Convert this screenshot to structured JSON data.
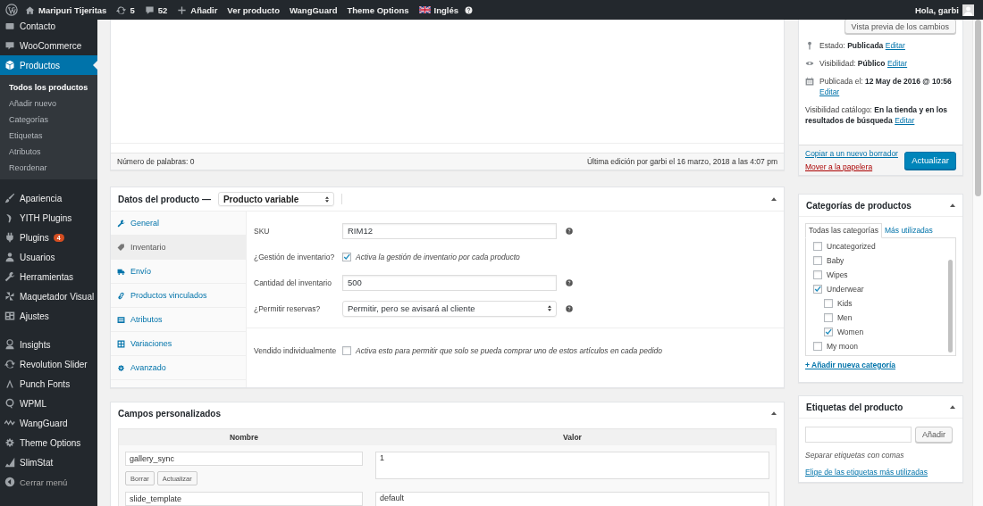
{
  "admin_bar": {
    "items": [
      {
        "kind": "home",
        "label": "Maripuri Tijeritas"
      },
      {
        "kind": "updates",
        "label": "5"
      },
      {
        "kind": "comments",
        "label": "52"
      },
      {
        "kind": "new",
        "label": "Añadir"
      },
      {
        "kind": "text",
        "label": "Ver producto"
      },
      {
        "kind": "text",
        "label": "WangGuard"
      },
      {
        "kind": "text",
        "label": "Theme Options"
      },
      {
        "kind": "language",
        "label": "Inglés"
      }
    ],
    "greeting": "Hola, garbi"
  },
  "sidebar": {
    "items": [
      {
        "kind": "item",
        "label": "Contacto",
        "selected": false
      },
      {
        "kind": "item",
        "label": "WooCommerce",
        "selected": false
      },
      {
        "kind": "item",
        "label": "Productos",
        "selected": true,
        "children": [
          {
            "label": "Todos los productos",
            "selected": true
          },
          {
            "label": "Añadir nuevo",
            "selected": false
          },
          {
            "label": "Categorías",
            "selected": false
          },
          {
            "label": "Etiquetas",
            "selected": false
          },
          {
            "label": "Atributos",
            "selected": false
          },
          {
            "label": "Reordenar",
            "selected": false
          }
        ]
      },
      {
        "kind": "separator"
      },
      {
        "kind": "item",
        "label": "Apariencia",
        "selected": false
      },
      {
        "kind": "item",
        "label": "YITH Plugins",
        "selected": false
      },
      {
        "kind": "item",
        "label": "Plugins",
        "selected": false,
        "badge": "4"
      },
      {
        "kind": "item",
        "label": "Usuarios",
        "selected": false
      },
      {
        "kind": "item",
        "label": "Herramientas",
        "selected": false
      },
      {
        "kind": "item",
        "label": "Maquetador Visual",
        "selected": false
      },
      {
        "kind": "item",
        "label": "Ajustes",
        "selected": false
      },
      {
        "kind": "separator"
      },
      {
        "kind": "item",
        "label": "Insights",
        "selected": false
      },
      {
        "kind": "item",
        "label": "Revolution Slider",
        "selected": false
      },
      {
        "kind": "item",
        "label": "Punch Fonts",
        "selected": false
      },
      {
        "kind": "item",
        "label": "WPML",
        "selected": false
      },
      {
        "kind": "item",
        "label": "WangGuard",
        "selected": false
      },
      {
        "kind": "item",
        "label": "Theme Options",
        "selected": false
      },
      {
        "kind": "item",
        "label": "SlimStat",
        "selected": false
      },
      {
        "kind": "collapse",
        "label": "Cerrar menú",
        "selected": false
      }
    ]
  },
  "editor": {
    "word_count": "Número de palabras: 0",
    "last_edit": "Última edición por garbi el 16 marzo, 2018 a las 4:07 pm"
  },
  "product_data": {
    "title": "Datos del producto —",
    "type": "Producto variable",
    "tabs": [
      {
        "label": "General",
        "selected": false
      },
      {
        "label": "Inventario",
        "selected": true
      },
      {
        "label": "Envío",
        "selected": false
      },
      {
        "label": "Productos vinculados",
        "selected": false
      },
      {
        "label": "Atributos",
        "selected": false
      },
      {
        "label": "Variaciones",
        "selected": false
      },
      {
        "label": "Avanzado",
        "selected": false
      }
    ],
    "field_groups": [
      [
        {
          "kind": "text",
          "label": "SKU",
          "value": "RIM12"
        },
        {
          "kind": "checkbox",
          "label": "¿Gestión de inventario?",
          "checked": true,
          "description": "Activa la gestión de inventario por cada producto"
        },
        {
          "kind": "text",
          "label": "Cantidad del inventario",
          "value": "500"
        },
        {
          "kind": "select",
          "label": "¿Permitir reservas?",
          "value": "Permitir, pero se avisará al cliente"
        }
      ],
      [
        {
          "kind": "checkbox",
          "label": "Vendido individualmente",
          "checked": false,
          "description": "Activa esto para permitir que solo se pueda comprar uno de estos artículos en cada pedido"
        }
      ]
    ]
  },
  "custom_fields": {
    "title": "Campos personalizados",
    "columns": [
      "Nombre",
      "Valor"
    ],
    "rows": [
      {
        "name": "gallery_sync",
        "value": "1",
        "buttons": [
          "Borrar",
          "Actualizar"
        ]
      },
      {
        "name": "slide_template",
        "value": "default"
      }
    ]
  },
  "publish": {
    "preview_button": "Vista previa de los cambios",
    "meta": [
      {
        "kind": "status",
        "label": "Estado:",
        "value": "Publicada",
        "link": "Editar"
      },
      {
        "kind": "visibility",
        "label": "Visibilidad:",
        "value": "Público",
        "link": "Editar"
      },
      {
        "kind": "date",
        "label": "Publicada el:",
        "value": "12 May de 2016 @ 10:56",
        "link": "Editar"
      },
      {
        "kind": "catalog",
        "label": "Visibilidad catálogo:",
        "value": "En la tienda y en los resultados de búsqueda",
        "link": "Editar"
      }
    ],
    "copy_link": "Copiar a un nuevo borrador",
    "trash_link": "Mover a la papelera",
    "update_button": "Actualizar"
  },
  "categories": {
    "title": "Categorías de productos",
    "tabs": [
      {
        "label": "Todas las categorías",
        "selected": true
      },
      {
        "label": "Más utilizadas",
        "selected": false
      }
    ],
    "items": [
      {
        "label": "Uncategorized",
        "checked": false
      },
      {
        "label": "Baby",
        "checked": false
      },
      {
        "label": "Wipes",
        "checked": false
      },
      {
        "label": "Underwear",
        "checked": true,
        "children": [
          {
            "label": "Kids",
            "checked": false
          },
          {
            "label": "Men",
            "checked": false
          },
          {
            "label": "Women",
            "checked": true
          }
        ]
      },
      {
        "label": "My moon",
        "checked": false
      }
    ],
    "add_link": "+ Añadir nueva categoría"
  },
  "tags": {
    "title": "Etiquetas del producto",
    "add_button": "Añadir",
    "hint": "Separar etiquetas con comas",
    "choose_link": "Elige de las etiquetas más utilizadas"
  }
}
